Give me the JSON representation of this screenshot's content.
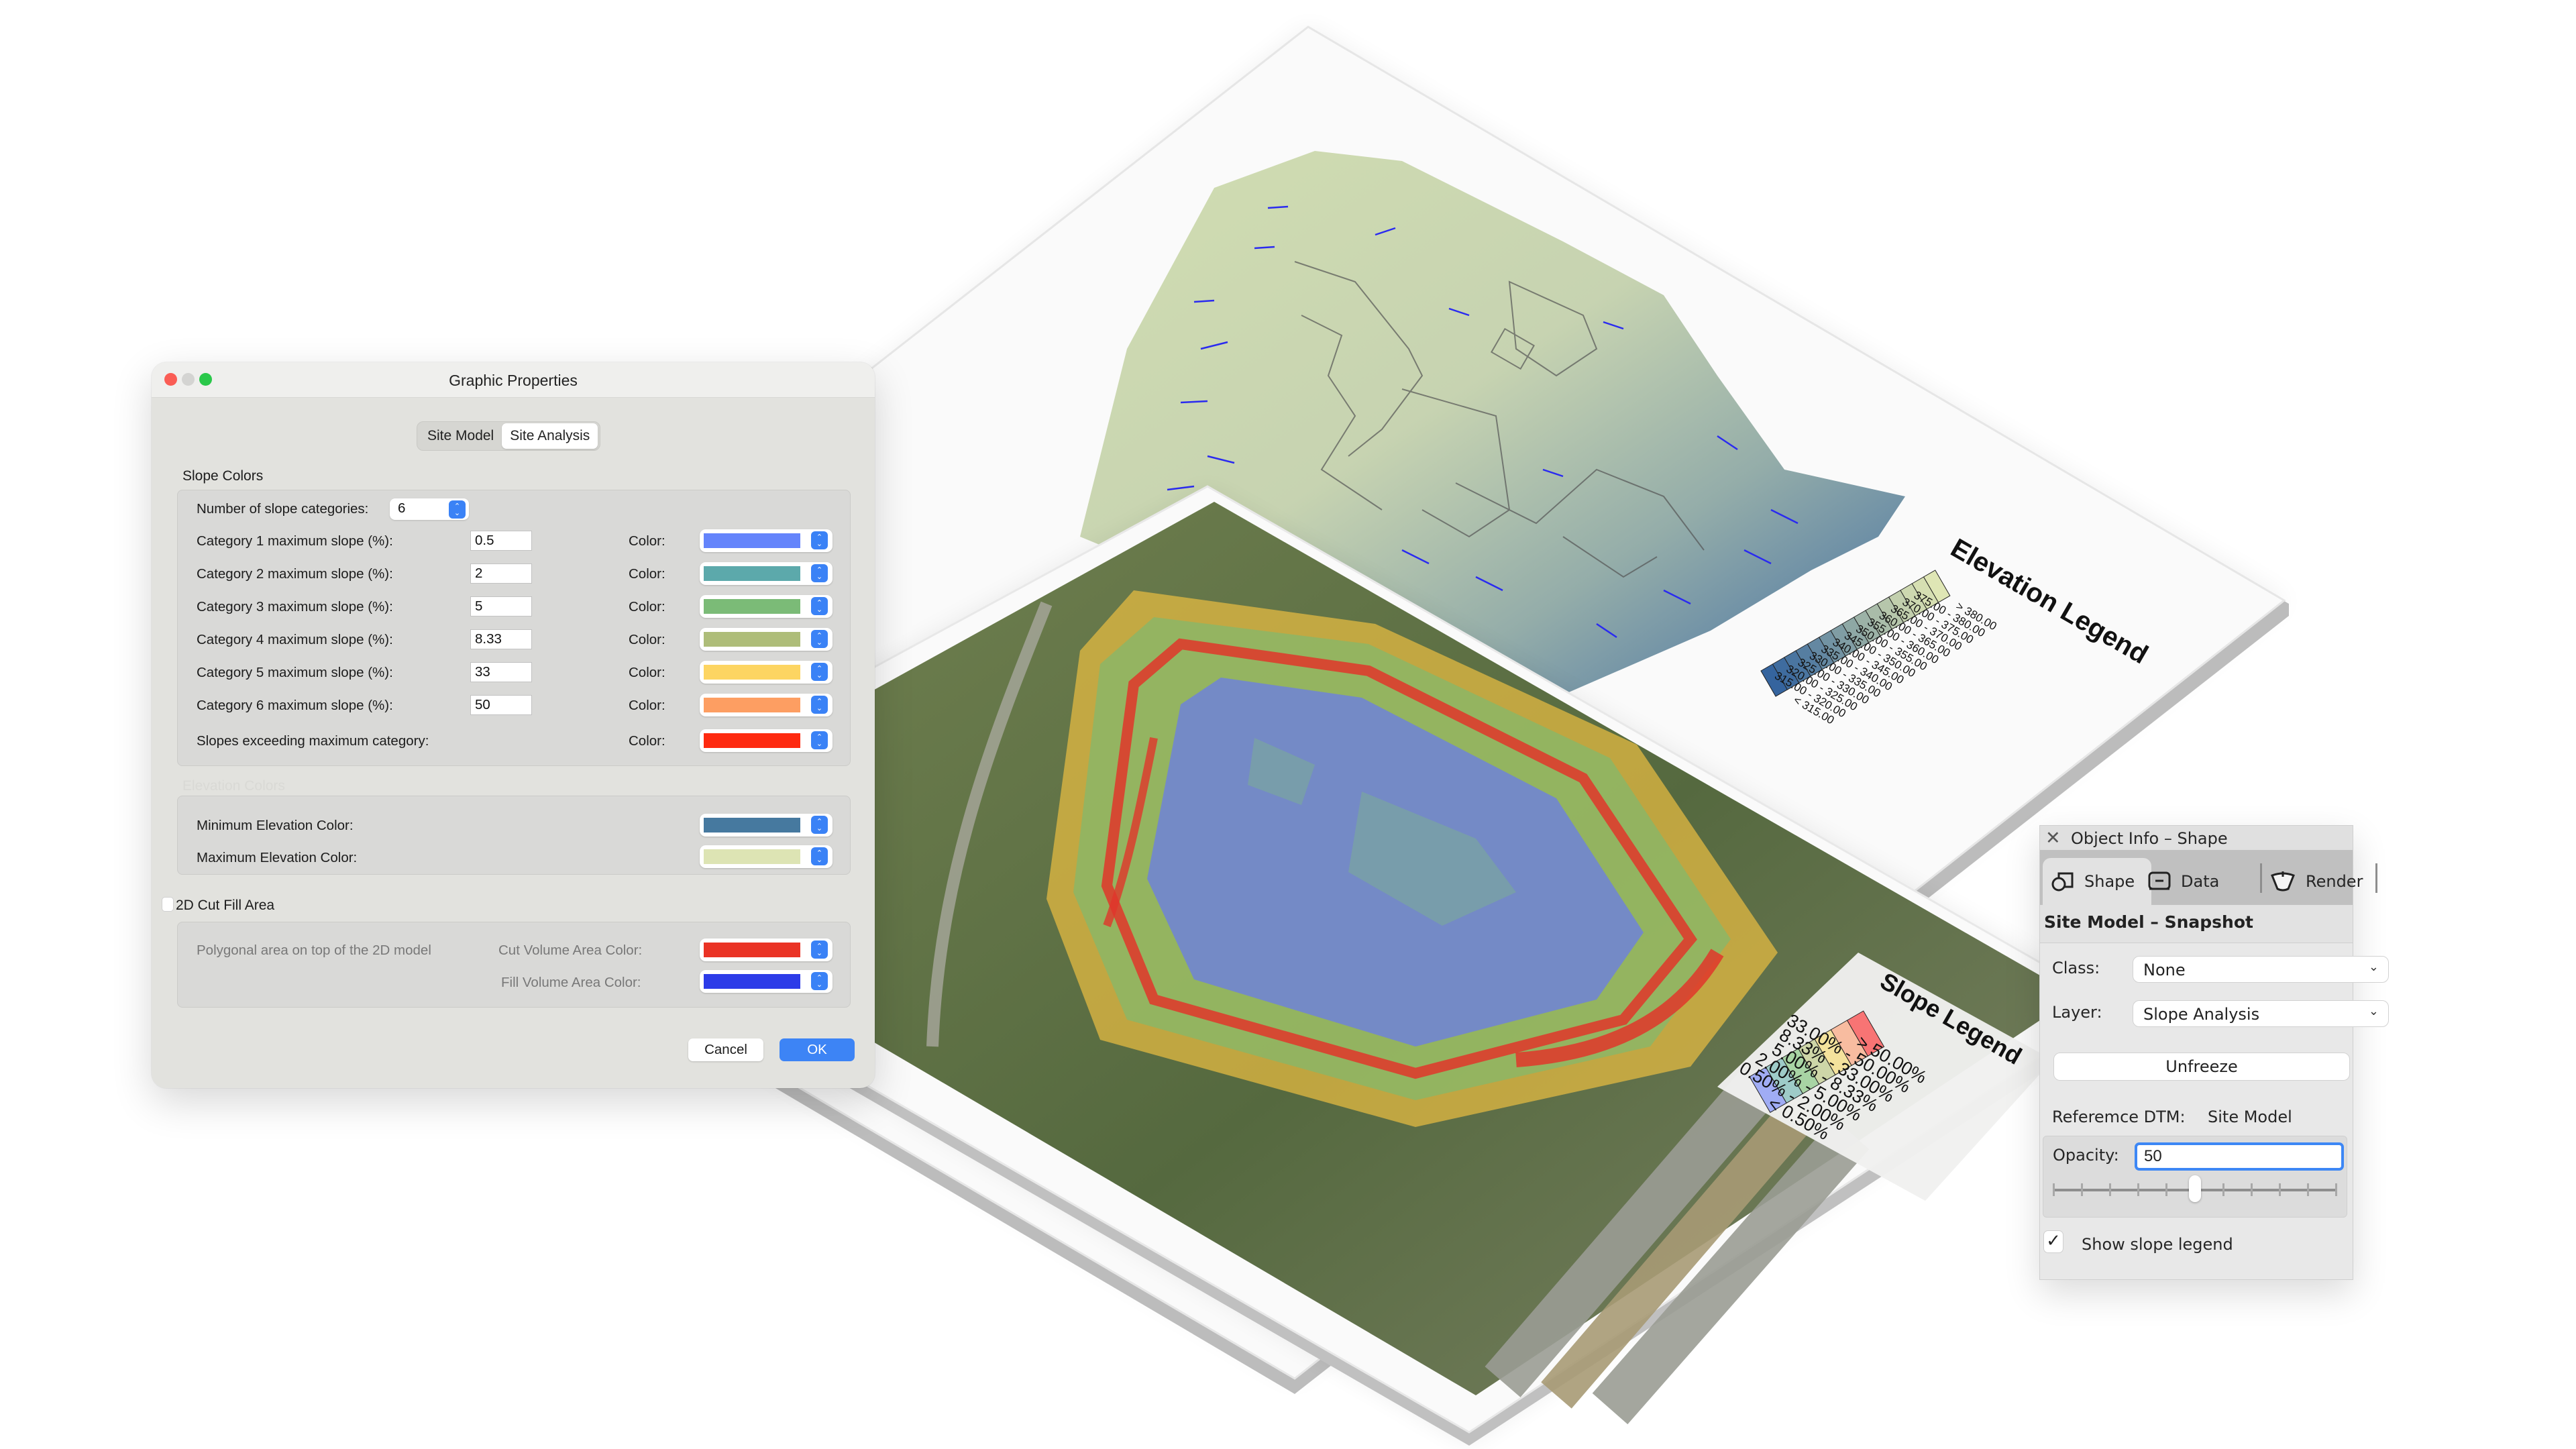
{
  "graphic_properties": {
    "title": "Graphic Properties",
    "tabs": [
      {
        "label": "Site Model",
        "active": false
      },
      {
        "label": "Site Analysis",
        "active": true
      }
    ],
    "slope_colors": {
      "section_title": "Slope Colors",
      "count_label": "Number of slope categories:",
      "count_value": "6",
      "color_label": "Color:",
      "categories": [
        {
          "label": "Category 1 maximum slope (%):",
          "value": "0.5",
          "color": "#6484fb"
        },
        {
          "label": "Category 2 maximum slope (%):",
          "value": "2",
          "color": "#5ca9ab"
        },
        {
          "label": "Category 3 maximum slope (%):",
          "value": "5",
          "color": "#7bbb77"
        },
        {
          "label": "Category 4 maximum slope (%):",
          "value": "8.33",
          "color": "#aebd79"
        },
        {
          "label": "Category 5 maximum slope (%):",
          "value": "33",
          "color": "#fdd562"
        },
        {
          "label": "Category 6 maximum slope (%):",
          "value": "50",
          "color": "#fd9e62"
        }
      ],
      "exceeding": {
        "label": "Slopes exceeding maximum category:",
        "color": "#fe2a10"
      }
    },
    "elevation_colors": {
      "section_title": "Elevation Colors",
      "min_label": "Minimum Elevation Color:",
      "min_color": "#46799f",
      "max_label": "Maximum Elevation Color:",
      "max_color": "#dde4b4"
    },
    "cut_fill": {
      "checkbox_label": "2D Cut Fill Area",
      "checked": false,
      "description": "Polygonal area on top of the 2D model",
      "cut_label": "Cut Volume Area Color:",
      "cut_color": "#ea3325",
      "fill_label": "Fill Volume Area Color:",
      "fill_color": "#2c3be8"
    },
    "buttons": {
      "cancel": "Cancel",
      "ok": "OK"
    }
  },
  "object_info": {
    "title": "Object Info – Shape",
    "close_icon": "close-icon",
    "tabs": [
      {
        "label": "Shape",
        "icon": "shape-icon",
        "active": true
      },
      {
        "label": "Data",
        "icon": "data-icon",
        "active": false
      },
      {
        "label": "Render",
        "icon": "render-teapot-icon",
        "active": false
      }
    ],
    "object_type": "Site Model – Snapshot",
    "class_label": "Class:",
    "class_value": "None",
    "layer_label": "Layer:",
    "layer_value": "Slope Analysis",
    "unfreeze_button": "Unfreeze",
    "reference_dtm_label": "Referemce DTM:",
    "reference_dtm_value": "Site Model",
    "opacity_label": "Opacity:",
    "opacity_value": "50",
    "opacity_slider_percent": 50,
    "show_slope_legend_label": "Show slope legend",
    "show_slope_legend_checked": true
  },
  "elevation_legend": {
    "title": "Elevation Legend",
    "entries": [
      {
        "range": "> 380.00",
        "color": "#dfe6b5"
      },
      {
        "range": "375.00 - 380.00",
        "color": "#d6dfb2"
      },
      {
        "range": "370.00 - 375.00",
        "color": "#cdd8b0"
      },
      {
        "range": "365.00 - 370.00",
        "color": "#c2cfad"
      },
      {
        "range": "360.00 - 365.00",
        "color": "#b6c6ab"
      },
      {
        "range": "355.00 - 360.00",
        "color": "#a9bca9"
      },
      {
        "range": "350.00 - 355.00",
        "color": "#9cb2a7"
      },
      {
        "range": "345.00 - 350.00",
        "color": "#8ea8a5"
      },
      {
        "range": "340.00 - 345.00",
        "color": "#809da4"
      },
      {
        "range": "335.00 - 340.00",
        "color": "#7293a3"
      },
      {
        "range": "330.00 - 335.00",
        "color": "#6488a2"
      },
      {
        "range": "325.00 - 330.00",
        "color": "#567ea1"
      },
      {
        "range": "320.00 - 325.00",
        "color": "#4a75a0"
      },
      {
        "range": "315.00 - 320.00",
        "color": "#3f6c9f"
      },
      {
        "range": "< 315.00",
        "color": "#35649e"
      }
    ]
  },
  "slope_legend": {
    "title": "Slope Legend",
    "entries": [
      {
        "range": "> 50.00%",
        "color": "#f87474"
      },
      {
        "range": "33.00% - 50.00%",
        "color": "#f8bca0"
      },
      {
        "range": "8.33% - 33.00%",
        "color": "#f4e29c"
      },
      {
        "range": "5.00% - 8.33%",
        "color": "#ced6a8"
      },
      {
        "range": "2.00% - 5.00%",
        "color": "#a8d4a4"
      },
      {
        "range": "0.50% - 2.00%",
        "color": "#9ecbc8"
      },
      {
        "range": "< 0.50%",
        "color": "#a0acf4"
      }
    ]
  }
}
